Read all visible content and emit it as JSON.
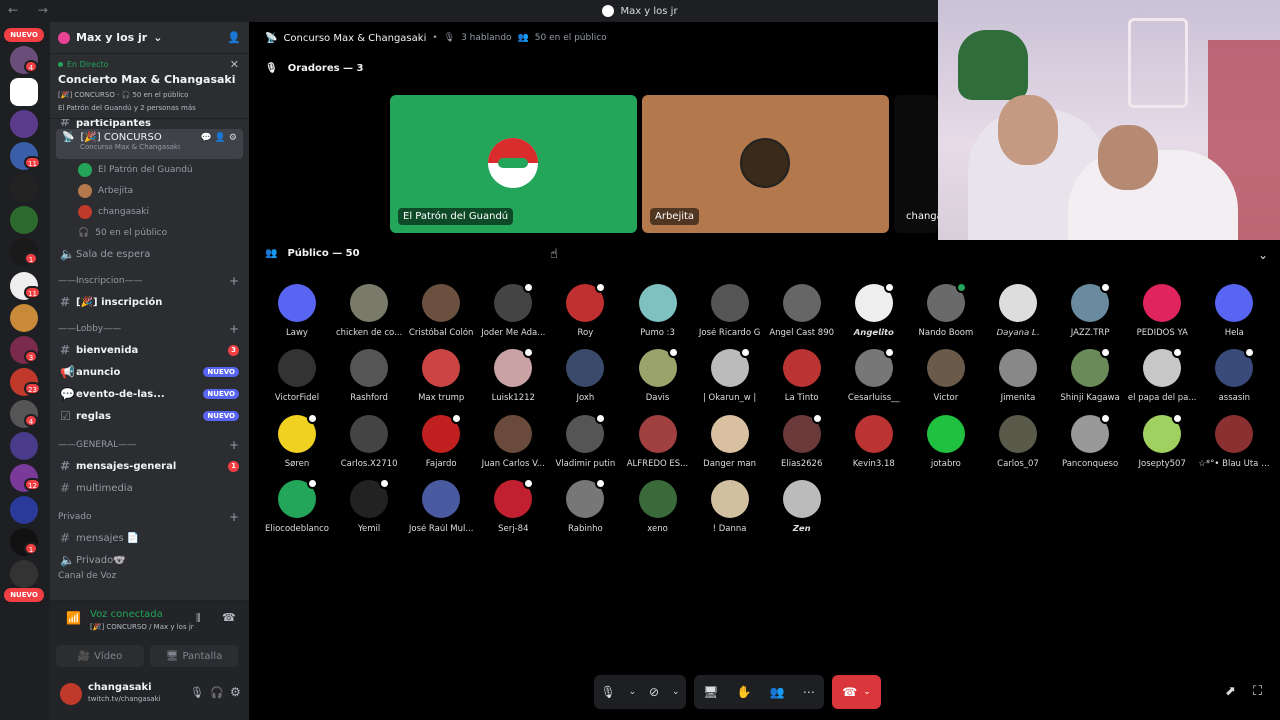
{
  "window": {
    "title": "Max y los jr"
  },
  "rail": {
    "nuevo_top": "NUEVO",
    "nuevo_bottom": "NUEVO",
    "badges": [
      "4",
      "11",
      "11",
      "1",
      "11",
      "3",
      "23",
      "4",
      "12",
      "1"
    ]
  },
  "server": {
    "name": "Max y los jr"
  },
  "live": {
    "status": "En Directo",
    "title": "Concierto Max & Changasaki",
    "sub1": "[🎉] CONCURSO · 🎧 50 en el público",
    "sub2": "El Patrón del Guandú y 2 personas más"
  },
  "channels": {
    "partial": "participantes",
    "concurso": "[🎉] CONCURSO",
    "concurso_sub": "Concurso Max & Changasaki",
    "members": [
      "El Patrón del Guandú",
      "Arbejita",
      "changasaki",
      "50 en el público"
    ],
    "sala": "Sala de espera",
    "cat_inscripcion": "——Inscripcion——",
    "inscripcion": "[🎉] inscripción",
    "cat_lobby": "——Lobby——",
    "bienvenida": "bienvenida",
    "bienvenida_count": "3",
    "anuncio": "anuncio",
    "evento": "evento-de-las...",
    "reglas": "reglas",
    "nuevo_tag": "NUEVO",
    "cat_general": "——GENERAL——",
    "mensajes_general": "mensajes-general",
    "mg_count": "1",
    "multimedia": "multimedia",
    "cat_privado": "Privado",
    "mensajes": "mensajes 📄",
    "privado": "Privado🐨",
    "cut": "Canal de Voz"
  },
  "voice": {
    "connected": "Voz conectada",
    "sub": "[🎉] CONCURSO / Max y los jr",
    "video": "Vídeo",
    "screen": "Pantalla"
  },
  "user": {
    "name": "changasaki",
    "status": "twitch.tv/changasaki"
  },
  "stage": {
    "title": "Concurso Max & Changasaki",
    "speaking": "3 hablando",
    "audience": "50 en el público",
    "speakers_label": "Oradores — 3",
    "public_label": "Público — 50",
    "speakers": [
      "El Patrón del Guandú",
      "Arbejita",
      "changa"
    ]
  },
  "audience": [
    "Lawy",
    "chicken de co...",
    "Cristóbal Colón",
    "Joder Me Ada...",
    "Roy",
    "Pumo :3",
    "José Ricardo G",
    "Angel Cast 890",
    "𝘼𝙣𝙜𝙚𝙡𝙞𝙩𝙤",
    "Nando Boom",
    "𝘋𝘢𝘺𝘢𝘯𝘢 𝘓.",
    "JAZZ.TRP",
    "PEDIDOS YA",
    "Hela",
    "VictorFidel",
    "Rashford",
    "Max trump",
    "Luisk1212",
    "Joxh",
    "Davis",
    "| Okarun_w |",
    "La Tinto",
    "Cesarluiss__",
    "Victor",
    "Jimenita",
    "Shinji Kagawa",
    "el papa del pa...",
    "assasin",
    "Søren",
    "Carlos.X2710",
    "Fajardo",
    "Juan Carlos V...",
    "Vladimir putin",
    "ALFREDO ES...",
    "Danger man",
    "Elias2626",
    "Kevin3.18",
    "jotabro",
    "Carlos_07",
    "Panconqueso",
    "Josepty507",
    "☆*°• Blau Uta •...",
    "Eliocodeblanco",
    "Yemil",
    "José Raúl Mul...",
    "Serj-84",
    "Rabinho",
    "xeno",
    "! Danna",
    "𝙕𝙚𝙣"
  ],
  "colors": {
    "speaker1": "#23a55a",
    "speaker2": "#b3784b",
    "accent": "#5865f2",
    "danger": "#da373c"
  }
}
